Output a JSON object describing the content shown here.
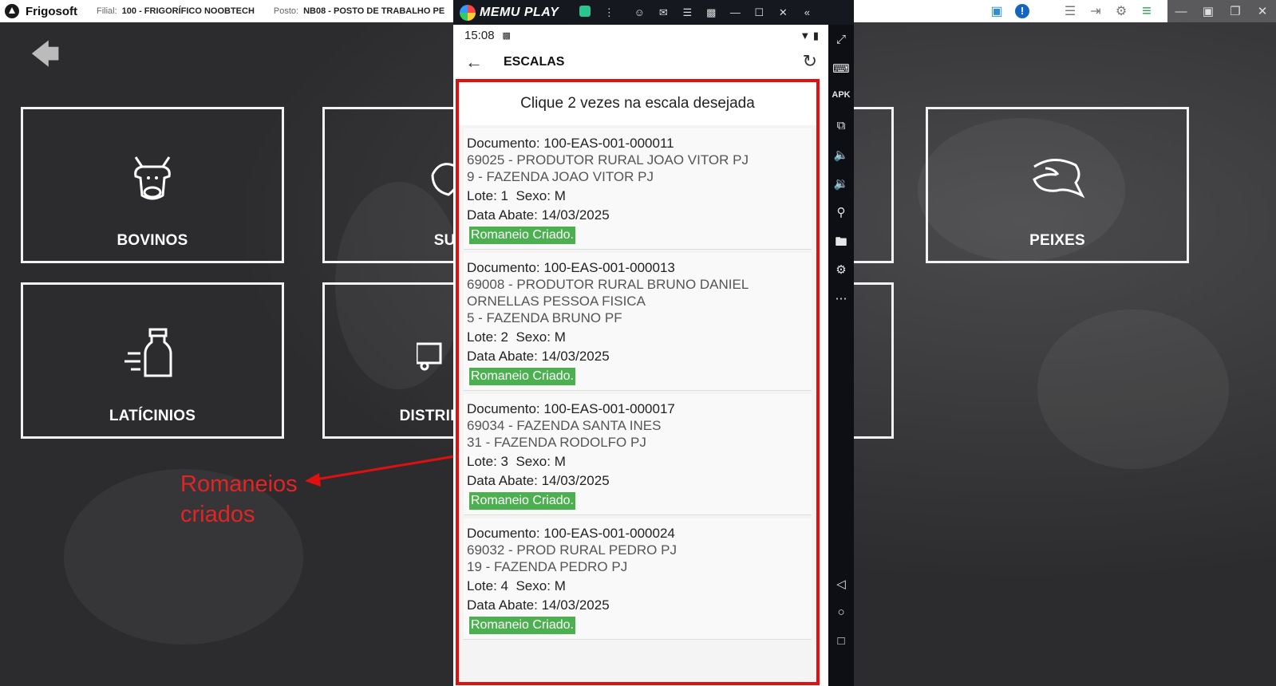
{
  "app": {
    "brand": "Frigosoft",
    "filial_label": "Filial:",
    "filial_value": "100 - FRIGORÍFICO NOOBTECH",
    "posto_label": "Posto:",
    "posto_value": "NB08 - POSTO DE TRABALHO PE"
  },
  "tiles": [
    {
      "label": "BOVINOS",
      "icon": "cow-icon"
    },
    {
      "label": "SUÍ",
      "icon": "pig-icon"
    },
    {
      "label": "PEIXES",
      "icon": "fish-icon"
    },
    {
      "label": "LATÍCINIOS",
      "icon": "milk-bottle-icon"
    },
    {
      "label": "DISTRIB",
      "icon": "truck-icon"
    }
  ],
  "annotation": {
    "line1": "Romaneios",
    "line2": "criados",
    "color": "#e32424"
  },
  "emulator": {
    "name": "MEMU PLAY"
  },
  "phone": {
    "time": "15:08",
    "title": "ESCALAS",
    "hint": "Clique 2 vezes na escala desejada",
    "items": [
      {
        "doc_label": "Documento:",
        "doc": "100-EAS-001-000011",
        "produtor": "69025 - PRODUTOR RURAL JOAO VITOR PJ",
        "fazenda": "9 - FAZENDA JOAO VITOR PJ",
        "lote_label": "Lote:",
        "lote": "1",
        "sexo_label": "Sexo:",
        "sexo": "M",
        "data_label": "Data Abate:",
        "data": "14/03/2025",
        "status": "Romaneio Criado."
      },
      {
        "doc_label": "Documento:",
        "doc": "100-EAS-001-000013",
        "produtor": "69008 - PRODUTOR RURAL BRUNO DANIEL ORNELLAS PESSOA FISICA",
        "fazenda": "5 - FAZENDA BRUNO PF",
        "lote_label": "Lote:",
        "lote": "2",
        "sexo_label": "Sexo:",
        "sexo": "M",
        "data_label": "Data Abate:",
        "data": "14/03/2025",
        "status": "Romaneio Criado."
      },
      {
        "doc_label": "Documento:",
        "doc": "100-EAS-001-000017",
        "produtor": "69034 - FAZENDA SANTA INES",
        "fazenda": "31 - FAZENDA RODOLFO PJ",
        "lote_label": "Lote:",
        "lote": "3",
        "sexo_label": "Sexo:",
        "sexo": "M",
        "data_label": "Data Abate:",
        "data": "14/03/2025",
        "status": "Romaneio Criado."
      },
      {
        "doc_label": "Documento:",
        "doc": "100-EAS-001-000024",
        "produtor": "69032 - PROD RURAL PEDRO PJ",
        "fazenda": "19 - FAZENDA PEDRO PJ",
        "lote_label": "Lote:",
        "lote": "4",
        "sexo_label": "Sexo:",
        "sexo": "M",
        "data_label": "Data Abate:",
        "data": "14/03/2025",
        "status": "Romaneio Criado."
      }
    ]
  },
  "colors": {
    "status_green": "#4caf50",
    "highlight_red": "#e01010"
  }
}
